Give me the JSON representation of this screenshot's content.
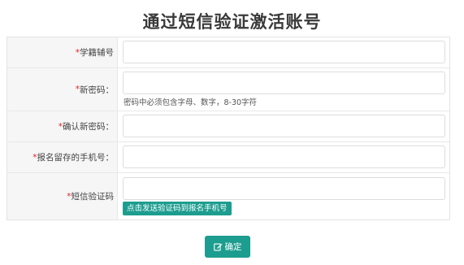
{
  "page": {
    "title": "通过短信验证激活账号"
  },
  "form": {
    "required_mark": "*",
    "student_id": {
      "label": "学籍辅号",
      "value": ""
    },
    "new_password": {
      "label": "新密码：",
      "value": "",
      "hint": "密码中必须包含字母、数字，8-30字符"
    },
    "confirm_password": {
      "label": "确认新密码：",
      "value": ""
    },
    "phone": {
      "label": "报名留存的手机号：",
      "value": ""
    },
    "sms_code": {
      "label": "短信验证码",
      "value": "",
      "send_button": "点击发送验证码到报名手机号"
    }
  },
  "actions": {
    "confirm_label": "确定",
    "confirm_icon": "edit-icon"
  },
  "colors": {
    "accent": "#1d9d8f",
    "required": "#e2232a",
    "label_bg": "#f6f6f6",
    "border": "#e3e3e3"
  }
}
